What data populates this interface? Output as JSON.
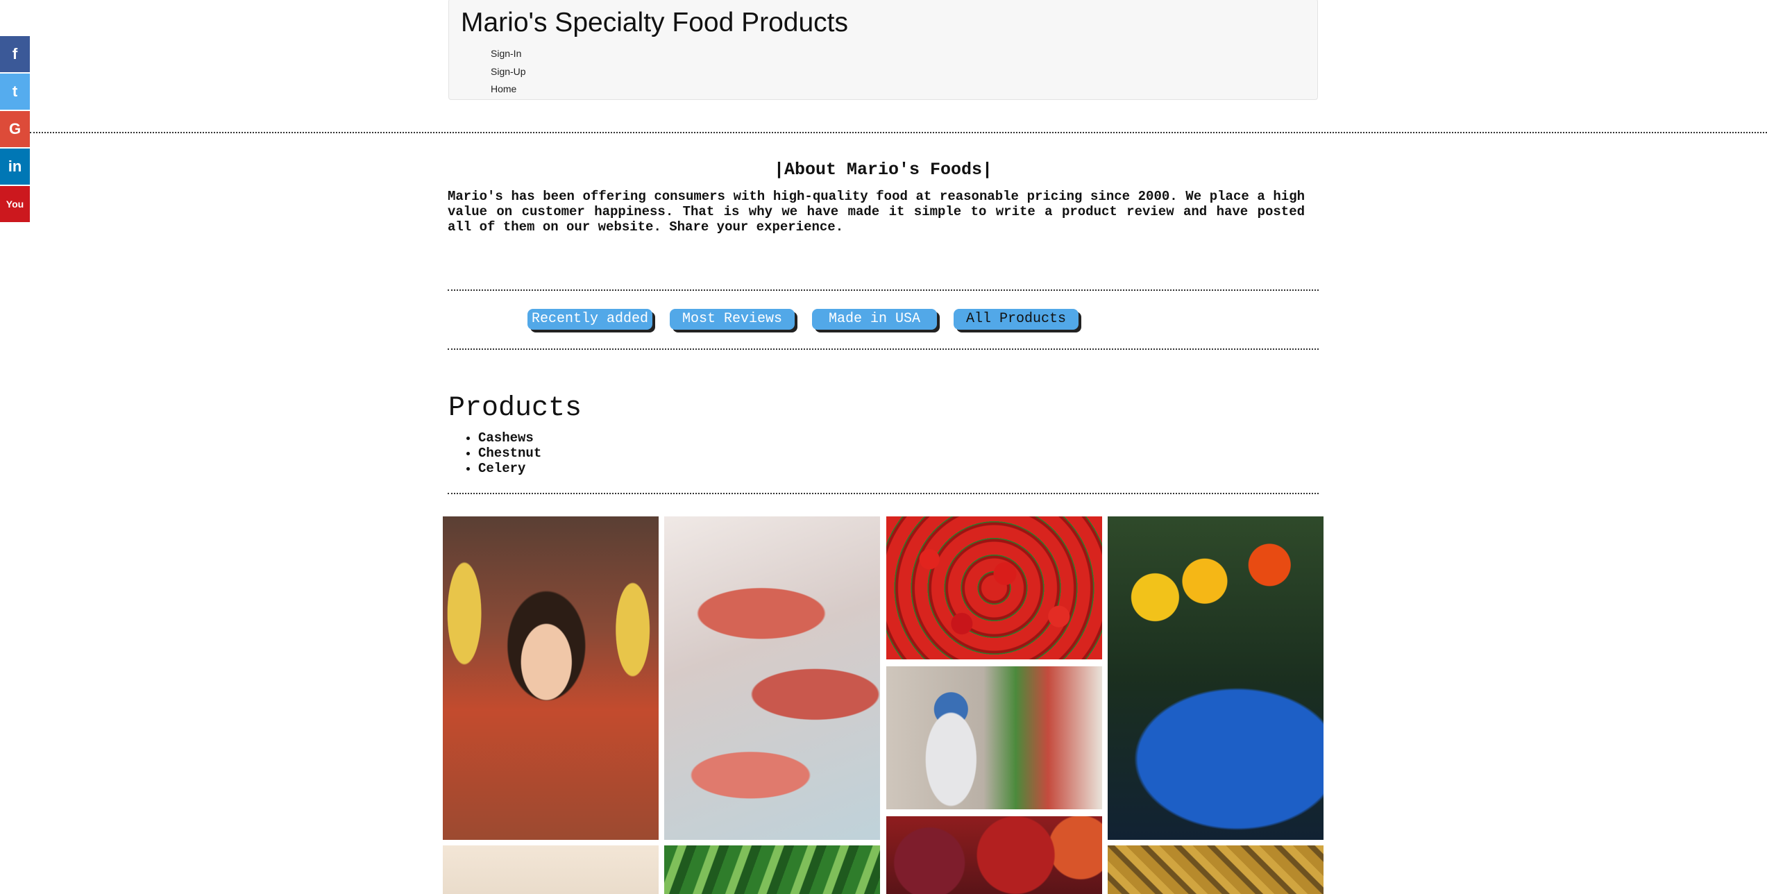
{
  "social": {
    "facebook": "f",
    "twitter": "t",
    "google": "G",
    "linkedin": "in",
    "youtube": "You"
  },
  "header": {
    "title": "Mario's Specialty Food Products",
    "nav": [
      "Sign-In",
      "Sign-Up",
      "Home"
    ]
  },
  "about": {
    "title": "|About Mario's Foods|",
    "text": "Mario's has been offering consumers with high-quality food at reasonable pricing since 2000. We place a high value on customer happiness. That is why we have made it simple to write a product review and have posted all of them on our website. Share your experience."
  },
  "filters": {
    "recent": "Recently added",
    "most_reviews": "Most Reviews",
    "made_usa": "Made in USA",
    "all": "All Products"
  },
  "products": {
    "heading": "Products",
    "items": [
      "Cashews",
      "Chestnut",
      "Celery"
    ]
  },
  "colors": {
    "accent": "#52a8e8",
    "facebook": "#3b5998",
    "twitter": "#55acee",
    "google": "#dd4b39",
    "linkedin": "#0077b5",
    "youtube": "#cc181e"
  }
}
